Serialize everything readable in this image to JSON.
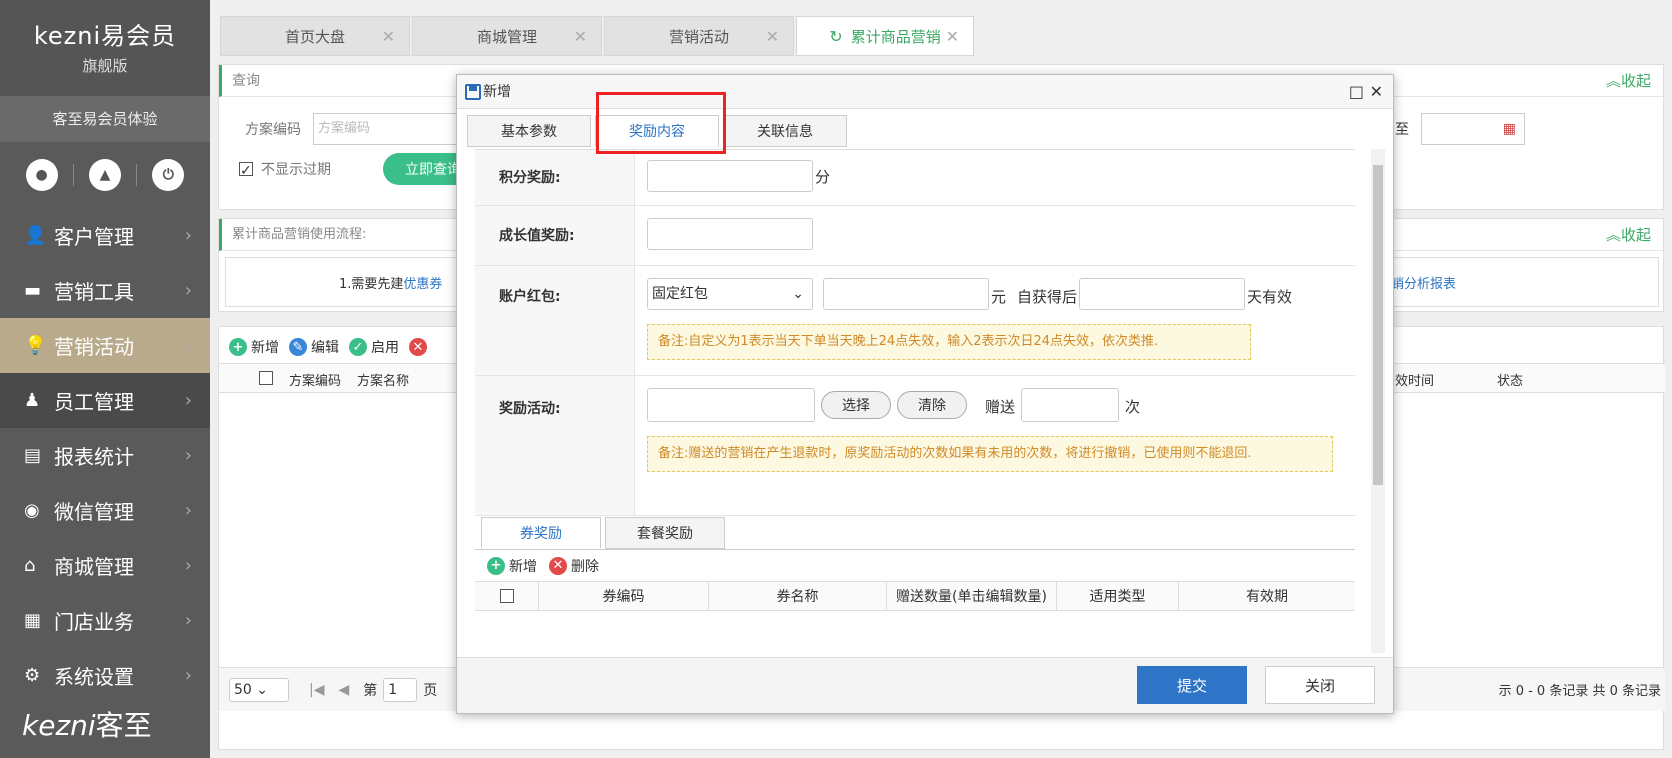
{
  "sidebar": {
    "logo_text": "kezni",
    "logo_cn": "易会员",
    "edition": "旗舰版",
    "member": "客至易会员体验",
    "items": [
      {
        "label": "客户管理",
        "icon": "user-icon"
      },
      {
        "label": "营销工具",
        "icon": "toolbox-icon"
      },
      {
        "label": "营销活动",
        "icon": "lightbulb-icon"
      },
      {
        "label": "员工管理",
        "icon": "staff-icon"
      },
      {
        "label": "报表统计",
        "icon": "report-icon"
      },
      {
        "label": "微信管理",
        "icon": "wechat-icon"
      },
      {
        "label": "商城管理",
        "icon": "mall-icon"
      },
      {
        "label": "门店业务",
        "icon": "store-icon"
      },
      {
        "label": "系统设置",
        "icon": "gear-icon"
      }
    ],
    "footer_logo": "kezni",
    "footer_cn": "客至"
  },
  "tabs": [
    {
      "label": "首页大盘"
    },
    {
      "label": "商城管理"
    },
    {
      "label": "营销活动"
    },
    {
      "label": "累计商品营销"
    }
  ],
  "query": {
    "title": "查询",
    "collapse": "收起",
    "code_label": "方案编码",
    "code_placeholder": "方案编码",
    "to": "至",
    "hide_expired": "不显示过期",
    "search_btn": "立即查询"
  },
  "flow": {
    "title": "累计商品营销使用流程:",
    "collapse": "收起",
    "step1_prefix": "1.需要先建",
    "step1_link": "优惠券",
    "report_link": "销分析报表"
  },
  "list": {
    "toolbar": {
      "add": "新增",
      "edit": "编辑",
      "enable": "启用"
    },
    "columns": [
      "方案编码",
      "方案名称"
    ],
    "right_columns": [
      "效时间",
      "状态"
    ],
    "page_size": "50",
    "page_prefix": "第",
    "page_no": "1",
    "page_suffix": "页",
    "records": "示 0 - 0 条记录 共 0 条记录"
  },
  "modal": {
    "title": "新增",
    "tabs": [
      "基本参数",
      "奖励内容",
      "关联信息"
    ],
    "points_label": "积分奖励:",
    "points_unit": "分",
    "growth_label": "成长值奖励:",
    "redpack_label": "账户红包:",
    "redpack_select": "固定红包",
    "yuan": "元",
    "from_get": "自获得后",
    "days_valid": "天有效",
    "note1": "备注:自定义为1表示当天下单当天晚上24点失效，输入2表示次日24点失效，依次类推.",
    "activity_label": "奖励活动:",
    "choose": "选择",
    "clear": "清除",
    "gift": "赠送",
    "times": "次",
    "note2": "备注:赠送的营销在产生退款时，原奖励活动的次数如果有未用的次数，将进行撤销，已使用则不能退回.",
    "subtabs": [
      "券奖励",
      "套餐奖励"
    ],
    "sub_add": "新增",
    "sub_delete": "删除",
    "columns": [
      "券编码",
      "券名称",
      "赠送数量(单击编辑数量)",
      "适用类型",
      "有效期"
    ],
    "submit": "提交",
    "close": "关闭"
  }
}
